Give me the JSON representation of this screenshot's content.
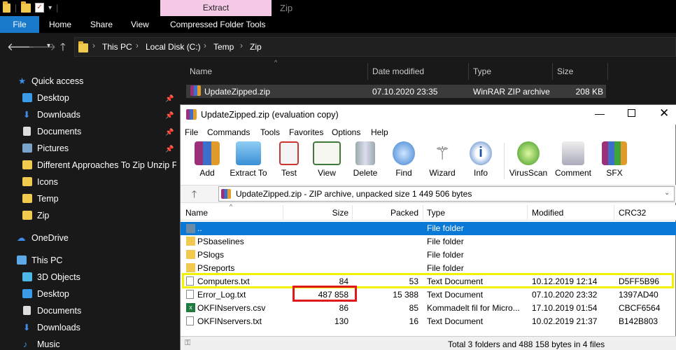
{
  "explorer": {
    "context_tab": "Extract",
    "window_title": "Zip",
    "ribbon_tabs": [
      "File",
      "Home",
      "Share",
      "View",
      "Compressed Folder Tools"
    ],
    "breadcrumb": [
      "This PC",
      "Local Disk (C:)",
      "Temp",
      "Zip"
    ],
    "columns": [
      "Name",
      "Date modified",
      "Type",
      "Size"
    ],
    "file_row": {
      "name": "UpdateZipped.zip",
      "date": "07.10.2020 23:35",
      "type": "WinRAR ZIP archive",
      "size": "208 KB"
    }
  },
  "nav": {
    "quick_access": "Quick access",
    "items": [
      "Desktop",
      "Downloads",
      "Documents",
      "Pictures",
      "Different Approaches To Zip Unzip Fil",
      "Icons",
      "Temp",
      "Zip"
    ],
    "onedrive": "OneDrive",
    "this_pc": "This PC",
    "pc_items": [
      "3D Objects",
      "Desktop",
      "Documents",
      "Downloads",
      "Music"
    ]
  },
  "rar": {
    "title": "UpdateZipped.zip (evaluation copy)",
    "menu": [
      "File",
      "Commands",
      "Tools",
      "Favorites",
      "Options",
      "Help"
    ],
    "toolbar": [
      "Add",
      "Extract To",
      "Test",
      "View",
      "Delete",
      "Find",
      "Wizard",
      "Info",
      "VirusScan",
      "Comment",
      "SFX"
    ],
    "path": "UpdateZipped.zip - ZIP archive, unpacked size 1 449 506 bytes",
    "columns": [
      "Name",
      "Size",
      "Packed",
      "Type",
      "Modified",
      "CRC32"
    ],
    "rows": [
      {
        "name": "..",
        "size": "",
        "packed": "",
        "type": "File folder",
        "modified": "",
        "crc": ""
      },
      {
        "name": "PSbaselines",
        "size": "",
        "packed": "",
        "type": "File folder",
        "modified": "",
        "crc": ""
      },
      {
        "name": "PSlogs",
        "size": "",
        "packed": "",
        "type": "File folder",
        "modified": "",
        "crc": ""
      },
      {
        "name": "PSreports",
        "size": "",
        "packed": "",
        "type": "File folder",
        "modified": "",
        "crc": ""
      },
      {
        "name": "Computers.txt",
        "size": "84",
        "packed": "53",
        "type": "Text Document",
        "modified": "10.12.2019 12:14",
        "crc": "D5FF5B96"
      },
      {
        "name": "Error_Log.txt",
        "size": "487 858",
        "packed": "15 388",
        "type": "Text Document",
        "modified": "07.10.2020 23:32",
        "crc": "1397AD40"
      },
      {
        "name": "OKFINservers.csv",
        "size": "86",
        "packed": "85",
        "type": "Kommadelt fil for Micro...",
        "modified": "17.10.2019 01:54",
        "crc": "CBCF6564"
      },
      {
        "name": "OKFINservers.txt",
        "size": "130",
        "packed": "16",
        "type": "Text Document",
        "modified": "10.02.2019 21:37",
        "crc": "B142B803"
      }
    ],
    "status": "Total 3 folders and 488 158 bytes in 4 files"
  },
  "colors": {
    "highlight_yellow": "#f2f200",
    "highlight_red": "#e0191b",
    "selected_row": "#0a78d7",
    "file_tab": "#1979ca"
  }
}
